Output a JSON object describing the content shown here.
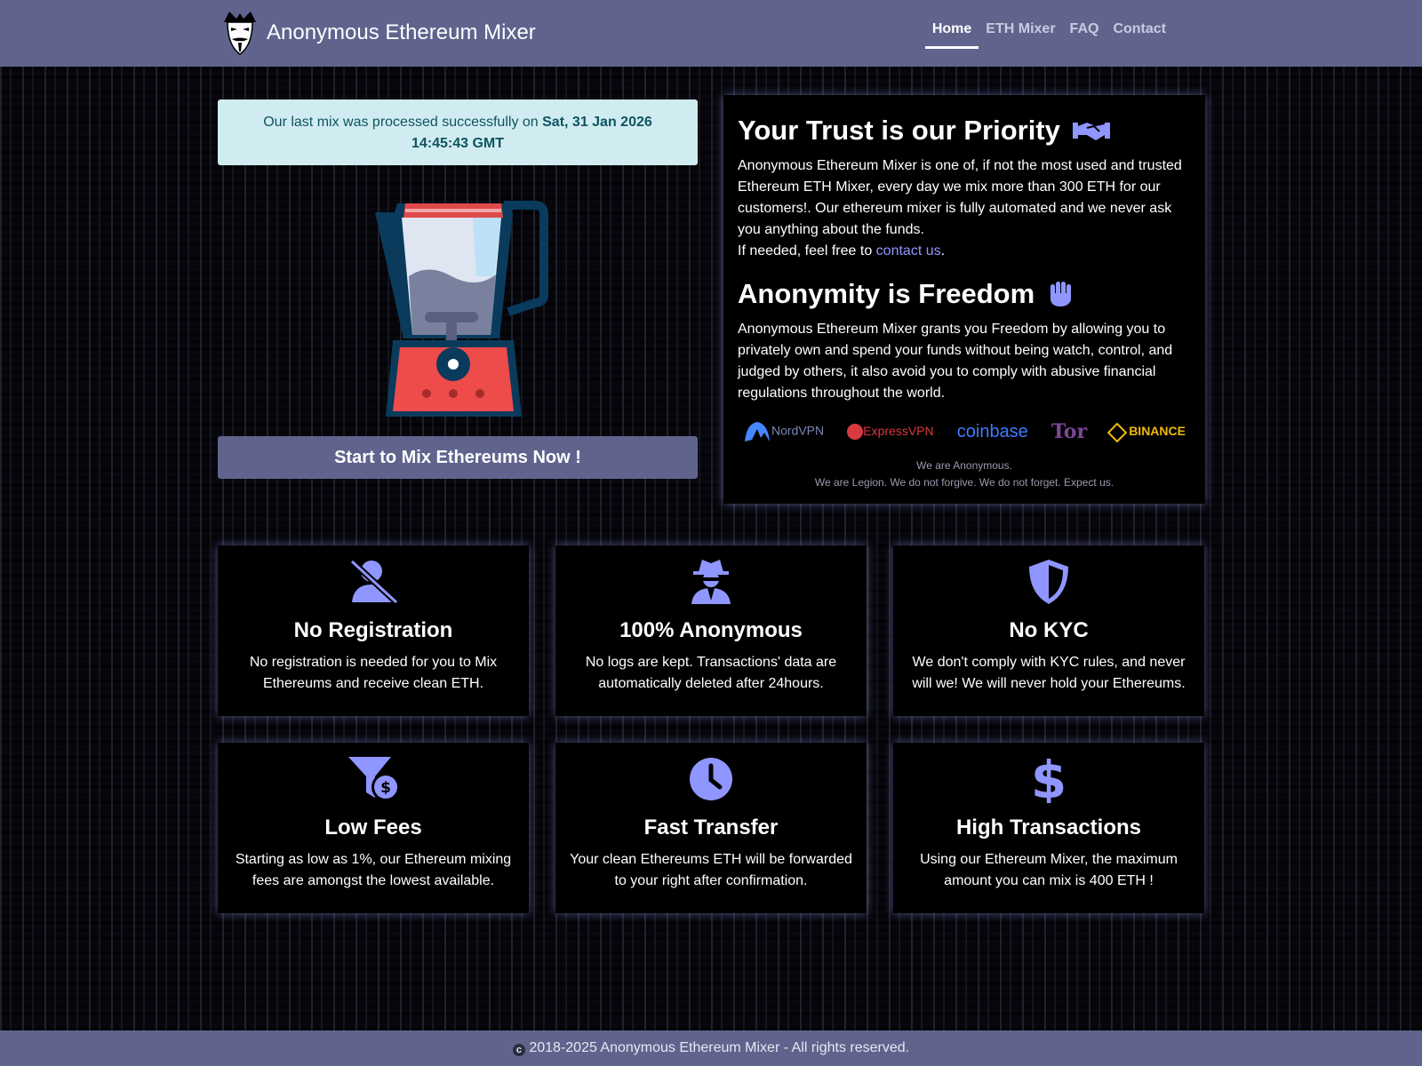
{
  "brand": {
    "name": "Anonymous Ethereum Mixer",
    "logo_icon": "anonymous-mask-icon"
  },
  "nav": {
    "items": [
      "Home",
      "ETH Mixer",
      "FAQ",
      "Contact"
    ],
    "active": "Home"
  },
  "alert": {
    "prefix": "Our last mix was processed successfully on ",
    "date": "Sat, 31 Jan 2026 14:45:43 GMT"
  },
  "hero": {
    "image_icon": "blender-icon",
    "cta_label": "Start to Mix Ethereums Now !"
  },
  "trust": {
    "title": "Your Trust is our Priority",
    "title_icon": "handshake-icon",
    "text": "Anonymous Ethereum Mixer is one of, if not the most used and trusted Ethereum ETH Mixer, every day we mix more than 300 ETH for our customers!. Our ethereum mixer is fully automated and we never ask you anything about the funds.",
    "contact_prefix": "If needed, feel free to ",
    "contact_link": "contact us",
    "contact_suffix": "."
  },
  "freedom": {
    "title": "Anonymity is Freedom",
    "title_icon": "hand-icon",
    "text": "Anonymous Ethereum Mixer grants you Freedom by allowing you to privately own and spend your funds without being watch, control, and judged by others, it also avoid you to comply with abusive financial regulations throughout the world."
  },
  "partners": [
    "NordVPN",
    "ExpressVPN",
    "coinbase",
    "Tor",
    "BINANCE"
  ],
  "quote": {
    "line1": "We are Anonymous.",
    "line2": "We are Legion. We do not forgive. We do not forget. Expect us."
  },
  "features": [
    {
      "icon": "user-slash-icon",
      "title": "No Registration",
      "text": "No registration is needed for you to Mix Ethereums and receive clean ETH."
    },
    {
      "icon": "user-secret-icon",
      "title": "100% Anonymous",
      "text": "No logs are kept. Transactions' data are automatically deleted after 24hours."
    },
    {
      "icon": "shield-icon",
      "title": "No KYC",
      "text": "We don't comply with KYC rules, and never will we! We will never hold your Ethereums."
    },
    {
      "icon": "funnel-dollar-icon",
      "title": "Low Fees",
      "text": "Starting as low as 1%, our Ethereum mixing fees are amongst the lowest available."
    },
    {
      "icon": "clock-icon",
      "title": "Fast Transfer",
      "text": "Your clean Ethereums ETH will be forwarded to your right after confirmation."
    },
    {
      "icon": "dollar-icon",
      "title": "High Transactions",
      "text": "Using our Ethereum Mixer, the maximum amount you can mix is 400 ETH !"
    }
  ],
  "footer": {
    "text": "2018-2025 Anonymous Ethereum Mixer - All rights reserved.",
    "icon": "copyright-icon"
  },
  "colors": {
    "header": "#60648d",
    "accent": "#8f96ff",
    "alert_bg": "#d1ecf1",
    "alert_text": "#0c5460"
  }
}
